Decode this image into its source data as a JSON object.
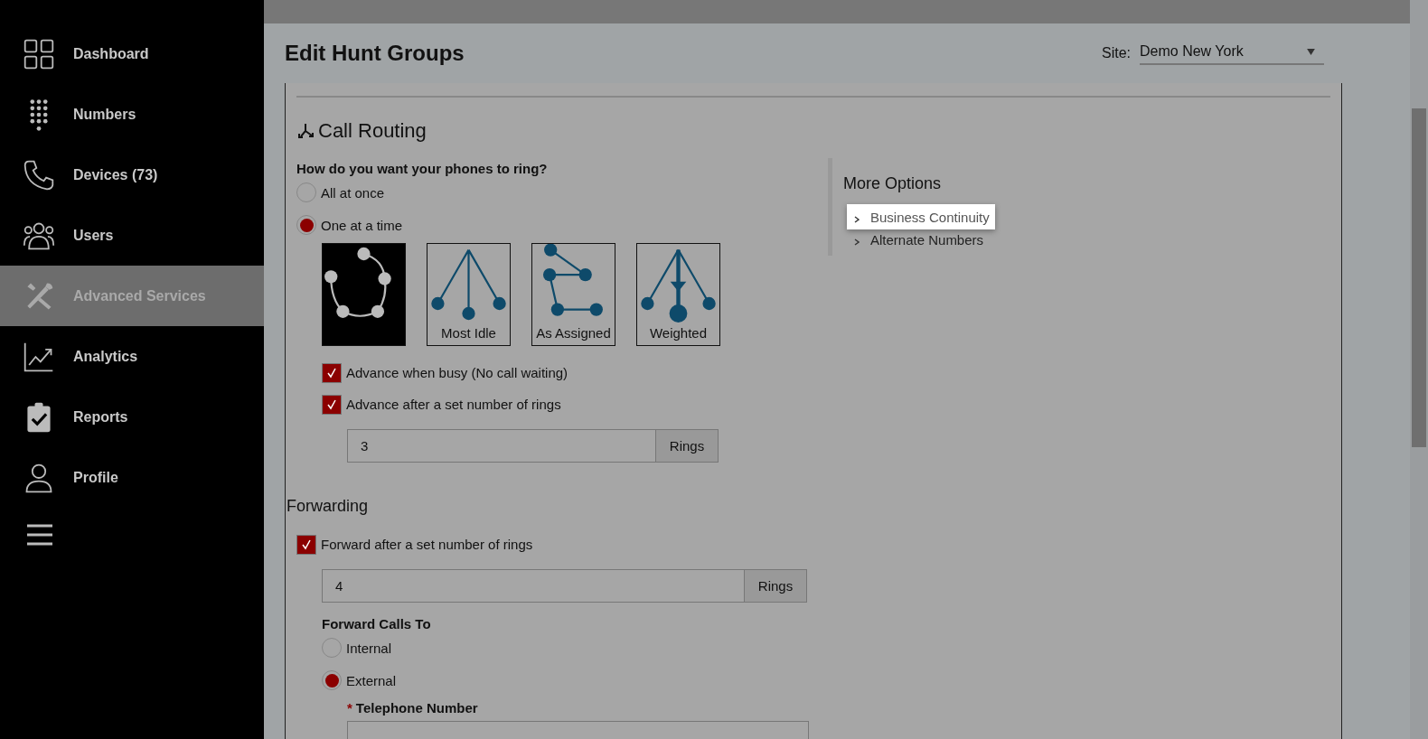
{
  "sidebar": {
    "items": [
      {
        "label": "Dashboard",
        "selected": false
      },
      {
        "label": "Numbers",
        "selected": false
      },
      {
        "label": "Devices (73)",
        "selected": false
      },
      {
        "label": "Users",
        "selected": false
      },
      {
        "label": "Advanced Services",
        "selected": true
      },
      {
        "label": "Analytics",
        "selected": false
      },
      {
        "label": "Reports",
        "selected": false
      },
      {
        "label": "Profile",
        "selected": false
      }
    ]
  },
  "header": {
    "title": "Edit Hunt Groups",
    "site_label": "Site:",
    "site_value": "Demo New York"
  },
  "call_routing": {
    "title": "Call Routing",
    "question": "How do you want your phones to ring?",
    "options": [
      {
        "label": "All at once",
        "selected": false
      },
      {
        "label": "One at a time",
        "selected": true
      }
    ],
    "patterns": [
      {
        "selected": true
      },
      {
        "label": "Most Idle",
        "selected": false
      },
      {
        "label": "As Assigned",
        "selected": false
      },
      {
        "label": "Weighted",
        "selected": false
      }
    ],
    "checkboxes": [
      {
        "label": "Advance when busy (No call waiting)",
        "checked": true
      },
      {
        "label": "Advance after a set number of rings",
        "checked": true
      }
    ],
    "rings": {
      "value": "3",
      "unit": "Rings"
    }
  },
  "forwarding": {
    "title": "Forwarding",
    "checkbox": {
      "label": "Forward after a set number of rings",
      "checked": true
    },
    "rings": {
      "value": "4",
      "unit": "Rings"
    },
    "forward_to_label": "Forward Calls To",
    "options": [
      {
        "label": "Internal",
        "selected": false
      },
      {
        "label": "External",
        "selected": true
      }
    ],
    "required_mark": "*",
    "phone_label": "Telephone Number"
  },
  "more_options": {
    "title": "More Options",
    "items": [
      {
        "label": "Business Continuity",
        "highlighted": true
      },
      {
        "label": "Alternate Numbers",
        "highlighted": false
      }
    ]
  }
}
